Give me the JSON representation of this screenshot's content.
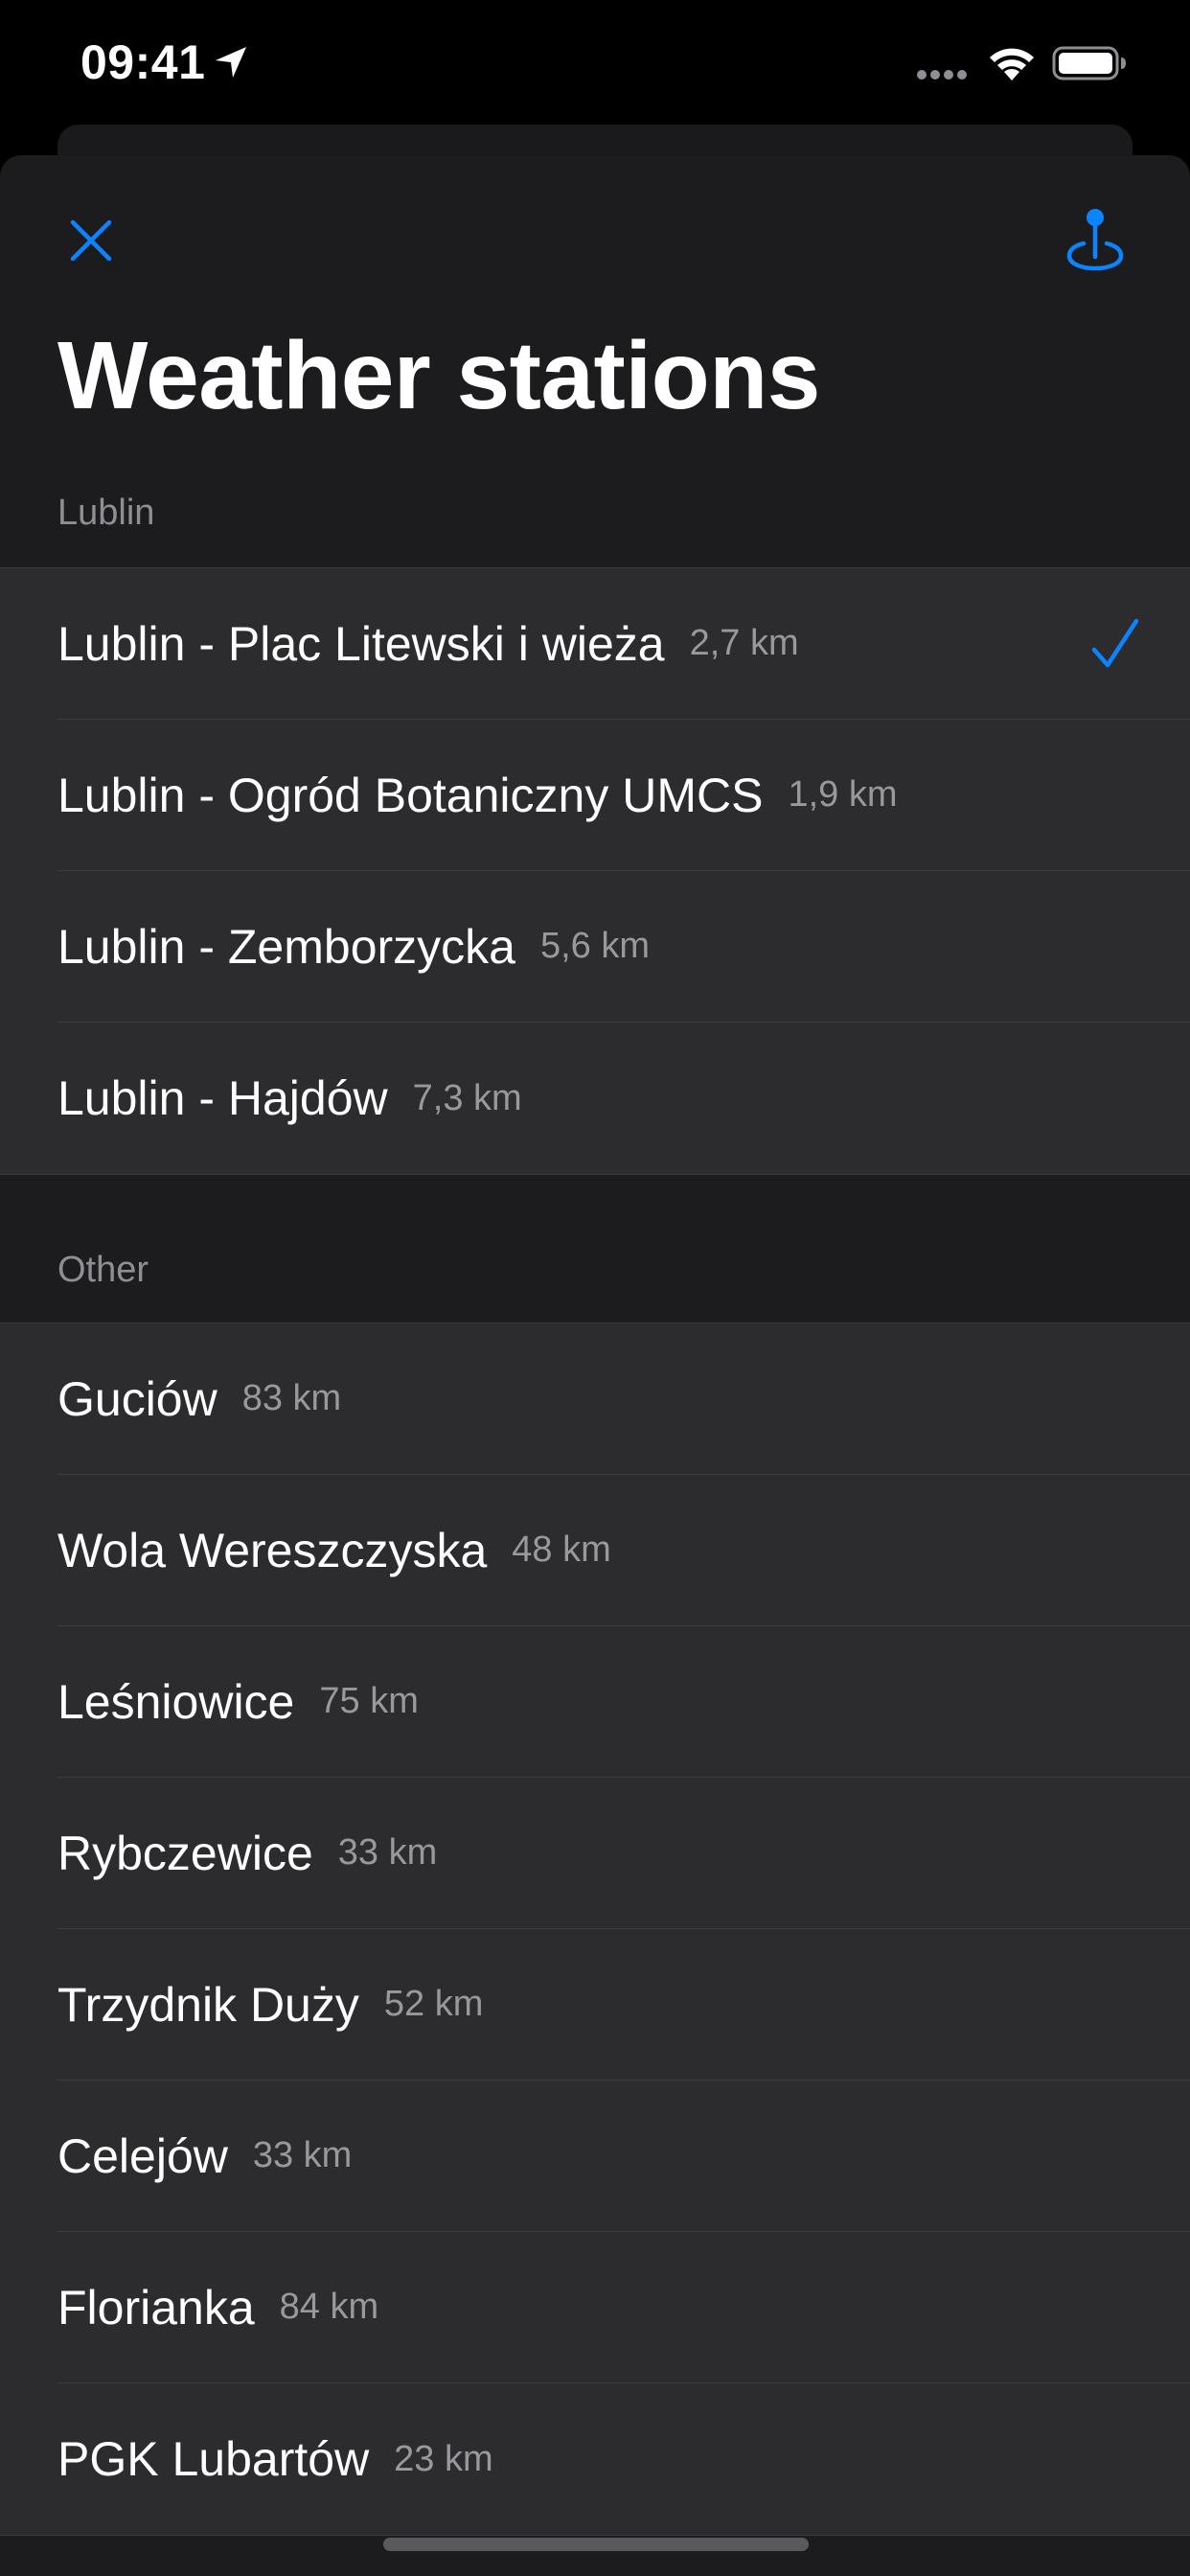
{
  "status_bar": {
    "time": "09:41"
  },
  "header": {
    "title": "Weather stations"
  },
  "sections": [
    {
      "header": "Lublin",
      "rows": [
        {
          "name": "Lublin - Plac Litewski i wieża",
          "distance": "2,7 km",
          "selected": true
        },
        {
          "name": "Lublin - Ogród Botaniczny UMCS",
          "distance": "1,9 km",
          "selected": false
        },
        {
          "name": "Lublin - Zemborzycka",
          "distance": "5,6 km",
          "selected": false
        },
        {
          "name": "Lublin - Hajdów",
          "distance": "7,3 km",
          "selected": false
        }
      ]
    },
    {
      "header": "Other",
      "rows": [
        {
          "name": "Guciów",
          "distance": "83 km",
          "selected": false
        },
        {
          "name": "Wola Wereszczyska",
          "distance": "48 km",
          "selected": false
        },
        {
          "name": "Leśniowice",
          "distance": "75 km",
          "selected": false
        },
        {
          "name": "Rybczewice",
          "distance": "33 km",
          "selected": false
        },
        {
          "name": "Trzydnik Duży",
          "distance": "52 km",
          "selected": false
        },
        {
          "name": "Celejów",
          "distance": "33 km",
          "selected": false
        },
        {
          "name": "Florianka",
          "distance": "84 km",
          "selected": false
        },
        {
          "name": "PGK Lubartów",
          "distance": "23 km",
          "selected": false
        }
      ]
    }
  ],
  "icons": {
    "close": "close-icon",
    "location": "location-pin-icon",
    "selected": "checkmark-icon"
  },
  "colors": {
    "accent": "#0a84ff",
    "background": "#000000",
    "sheet": "#1c1c1e",
    "row": "#2c2c2e",
    "secondary_text": "#8e8e93"
  }
}
